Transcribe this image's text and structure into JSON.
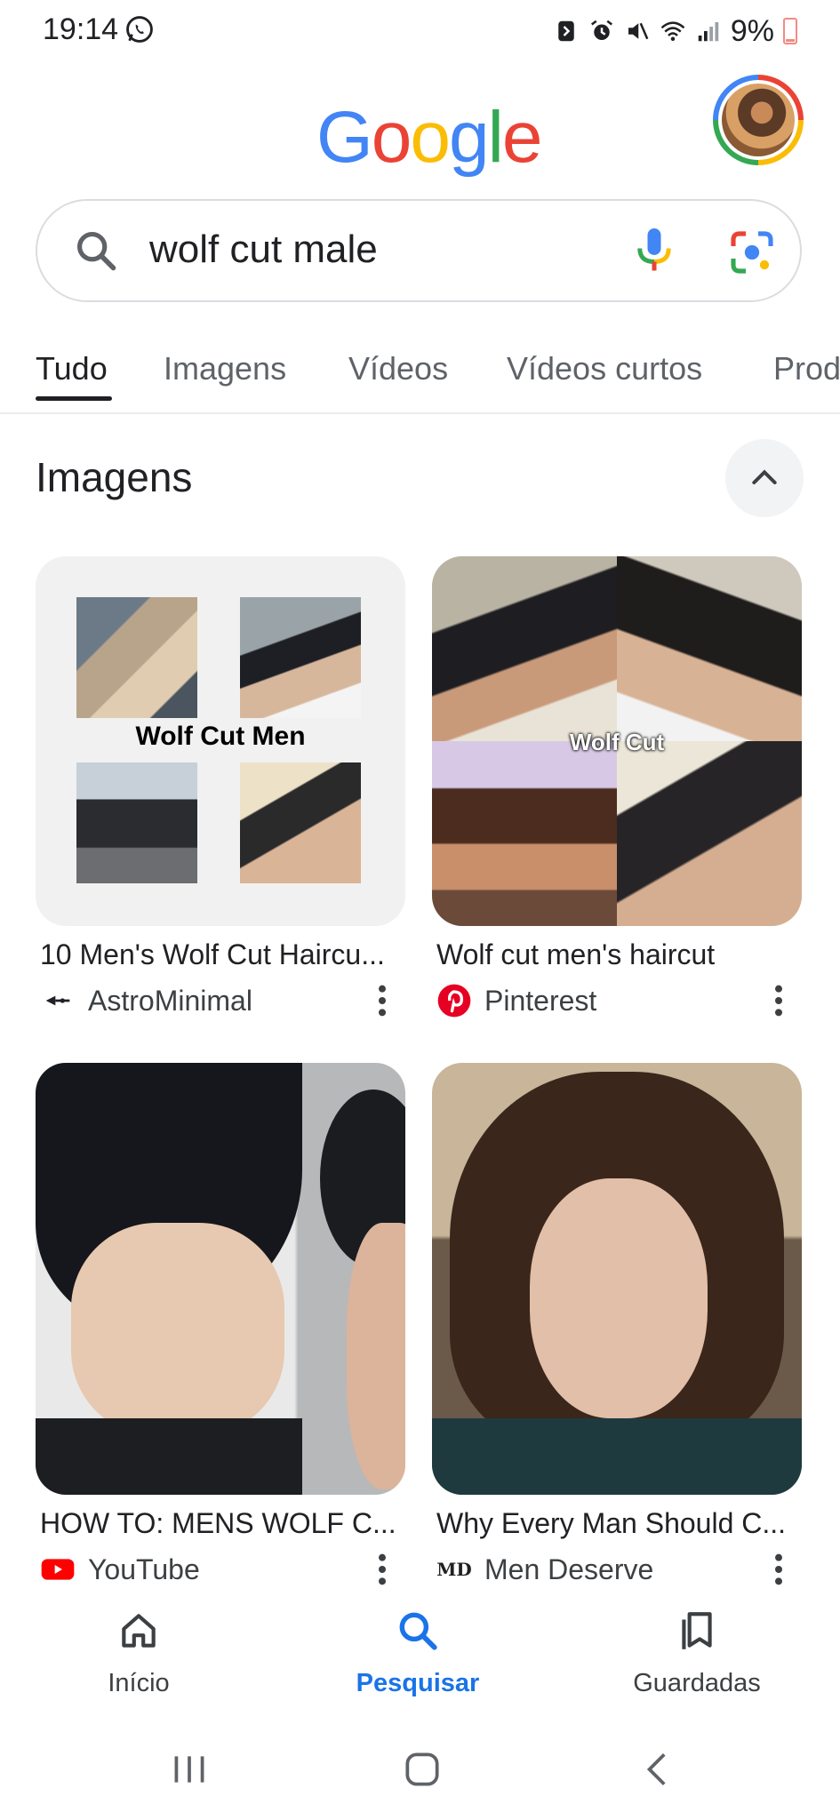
{
  "status_bar": {
    "time": "19:14",
    "battery_percent": "9%",
    "icons": [
      "whatsapp-icon",
      "nfc-icon",
      "alarm-icon",
      "mute-icon",
      "wifi-icon",
      "signal-icon",
      "battery-icon"
    ]
  },
  "header": {
    "logo_letters": [
      "G",
      "o",
      "o",
      "g",
      "l",
      "e"
    ],
    "logo_colors": [
      "#4285f4",
      "#ea4335",
      "#fbbc05",
      "#4285f4",
      "#34a853",
      "#ea4335"
    ]
  },
  "search": {
    "query": "wolf cut male"
  },
  "tabs": [
    {
      "label": "Tudo",
      "active": true
    },
    {
      "label": "Imagens",
      "active": false
    },
    {
      "label": "Vídeos",
      "active": false
    },
    {
      "label": "Vídeos curtos",
      "active": false
    },
    {
      "label": "Prod",
      "active": false
    }
  ],
  "images_section": {
    "title": "Imagens",
    "results": [
      {
        "title": "10 Men's Wolf Cut Haircu...",
        "source": "AstroMinimal",
        "overlay_text": "Wolf Cut Men"
      },
      {
        "title": "Wolf cut men's haircut",
        "source": "Pinterest",
        "overlay_text": "Wolf Cut"
      },
      {
        "title": "HOW TO: MENS WOLF C...",
        "source": "YouTube"
      },
      {
        "title": "Why Every Man Should C...",
        "source": "Men Deserve",
        "source_badge": "MD"
      }
    ]
  },
  "bottom_nav": {
    "items": [
      {
        "label": "Início",
        "icon": "home-icon",
        "active": false
      },
      {
        "label": "Pesquisar",
        "icon": "search-icon",
        "active": true
      },
      {
        "label": "Guardadas",
        "icon": "bookmarks-icon",
        "active": false
      }
    ]
  },
  "colors": {
    "accent": "#1a73e8",
    "text_primary": "#202124",
    "text_secondary": "#5f6368"
  }
}
